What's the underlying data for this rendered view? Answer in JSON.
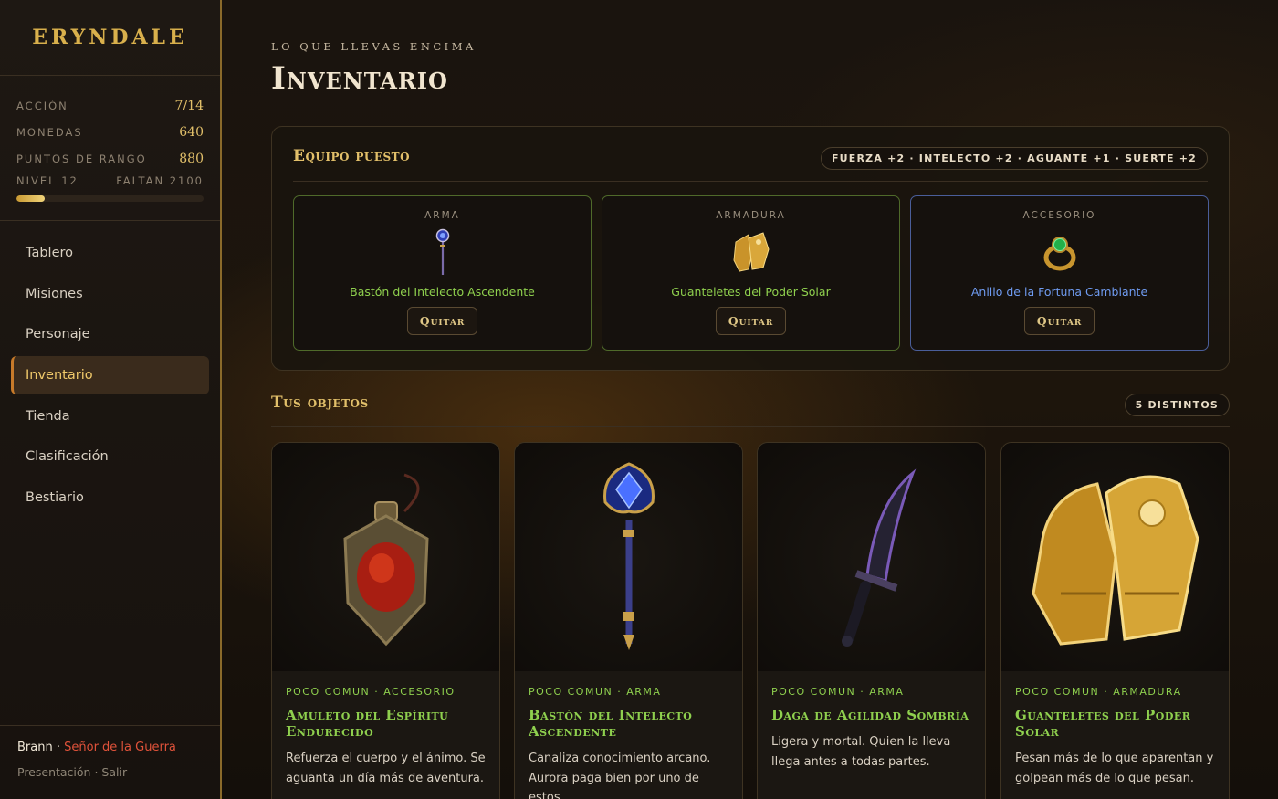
{
  "brand": "ERYNDALE",
  "stats": [
    {
      "label": "ACCIÓN",
      "value": "7/14"
    },
    {
      "label": "MONEDAS",
      "value": "640"
    },
    {
      "label": "PUNTOS DE RANGO",
      "value": "880"
    }
  ],
  "level": {
    "label": "NIVEL 12",
    "remaining": "FALTAN 2100",
    "progress": 0.15
  },
  "nav": [
    {
      "label": "Tablero"
    },
    {
      "label": "Misiones"
    },
    {
      "label": "Personaje"
    },
    {
      "label": "Inventario",
      "active": true
    },
    {
      "label": "Tienda"
    },
    {
      "label": "Clasificación"
    },
    {
      "label": "Bestiario"
    }
  ],
  "user": {
    "name": "Brann",
    "separator": " · ",
    "role": "Señor de la Guerra"
  },
  "footer_links": {
    "presentation": "Presentación",
    "separator": " · ",
    "logout": "Salir"
  },
  "header": {
    "eyebrow": "LO QUE LLEVAS ENCIMA",
    "title": "Inventario"
  },
  "equipped": {
    "title": "Equipo puesto",
    "bonus": "FUERZA +2 · INTELECTO +2 · AGUANTE +1 · SUERTE +2",
    "slots": [
      {
        "category": "ARMA",
        "name": "Bastón del Intelecto Ascendente",
        "button": "Quitar",
        "icon": "staff-icon"
      },
      {
        "category": "ARMADURA",
        "name": "Guanteletes del Poder Solar",
        "button": "Quitar",
        "icon": "gauntlets-icon"
      },
      {
        "category": "ACCESORIO",
        "name": "Anillo de la Fortuna Cambiante",
        "button": "Quitar",
        "icon": "ring-icon"
      }
    ]
  },
  "items": {
    "title": "Tus objetos",
    "count": "5 DISTINTOS",
    "cards": [
      {
        "meta": "POCO COMUN · ACCESORIO",
        "name": "Amuleto del Espíritu Endurecido",
        "desc": "Refuerza el cuerpo y el ánimo. Se aguanta un día más de aventura.",
        "icon": "amulet-icon"
      },
      {
        "meta": "POCO COMUN · ARMA",
        "name": "Bastón del Intelecto Ascendente",
        "desc": "Canaliza conocimiento arcano. Aurora paga bien por uno de estos.",
        "icon": "staff-icon"
      },
      {
        "meta": "POCO COMUN · ARMA",
        "name": "Daga de Agilidad Sombría",
        "desc": "Ligera y mortal. Quien la lleva llega antes a todas partes.",
        "icon": "dagger-icon"
      },
      {
        "meta": "POCO COMUN · ARMADURA",
        "name": "Guanteletes del Poder Solar",
        "desc": "Pesan más de lo que aparentan y golpean más de lo que pesan.",
        "icon": "gauntlets-icon"
      }
    ]
  },
  "colors": {
    "accent_gold": "#e2c06a",
    "uncommon_green": "#8fd04e",
    "accessory_blue": "#6f9bf0",
    "role_red": "#e0523a"
  }
}
